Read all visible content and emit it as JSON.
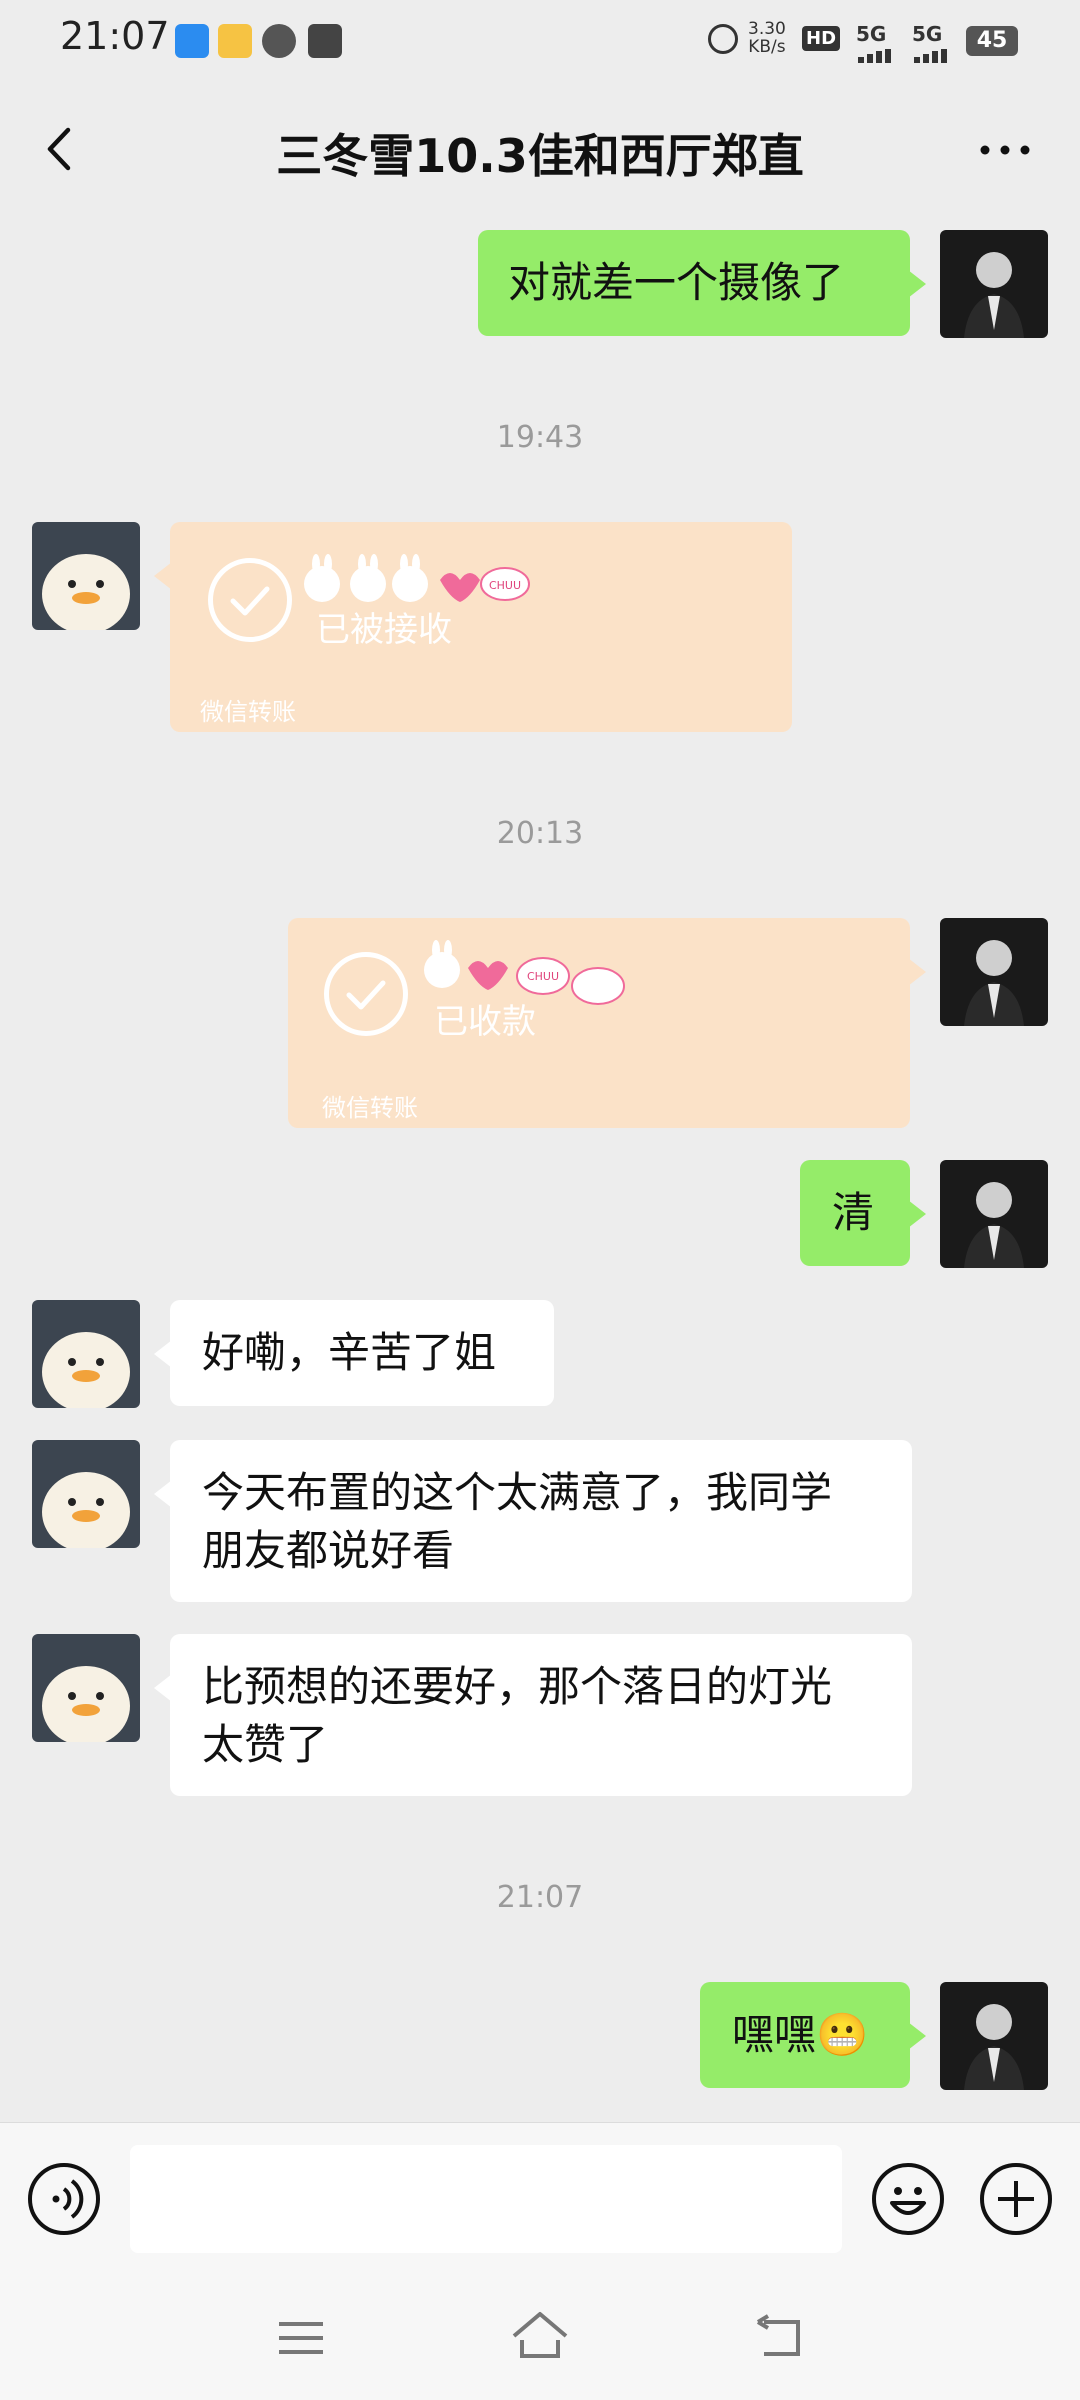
{
  "status_bar": {
    "time": "21:07",
    "net_speed": "3.30",
    "net_unit": "KB/s",
    "hd_label": "HD",
    "network_1": "5G",
    "network_2": "5G",
    "battery": "45"
  },
  "header": {
    "title": "三冬雪10.3佳和西厅郑直",
    "back_icon": "chevron-left-icon",
    "more_icon": "more-dots-icon"
  },
  "messages": [
    {
      "id": "m1",
      "side": "right",
      "type": "text",
      "text": "对就差一个摄像了"
    },
    {
      "id": "t1",
      "type": "timestamp",
      "text": "19:43"
    },
    {
      "id": "m2",
      "side": "left",
      "type": "transfer",
      "status": "已被接收",
      "footer": "微信转账",
      "sticker": "CHUU"
    },
    {
      "id": "t2",
      "type": "timestamp",
      "text": "20:13"
    },
    {
      "id": "m3",
      "side": "right",
      "type": "transfer",
      "status": "已收款",
      "footer": "微信转账",
      "sticker": "CHUU"
    },
    {
      "id": "m4",
      "side": "right",
      "type": "text",
      "text": "清"
    },
    {
      "id": "m5",
      "side": "left",
      "type": "text",
      "text": "好嘞，辛苦了姐"
    },
    {
      "id": "m6",
      "side": "left",
      "type": "text",
      "line1": "今天布置的这个太满意了，我同学",
      "line2": "朋友都说好看"
    },
    {
      "id": "m7",
      "side": "left",
      "type": "text",
      "line1": "比预想的还要好，那个落日的灯光",
      "line2": "太赞了"
    },
    {
      "id": "t3",
      "type": "timestamp",
      "text": "21:07"
    },
    {
      "id": "m8",
      "side": "right",
      "type": "text",
      "text": "嘿嘿",
      "emoji": "😬"
    }
  ],
  "input_bar": {
    "voice_icon": "voice-icon",
    "message_value": "",
    "emoji_icon": "emoji-icon",
    "plus_icon": "plus-icon"
  },
  "colors": {
    "green_bubble": "#95ec69",
    "white_bubble": "#ffffff",
    "transfer_bubble": "#fbe2c8",
    "background": "#ededed"
  }
}
